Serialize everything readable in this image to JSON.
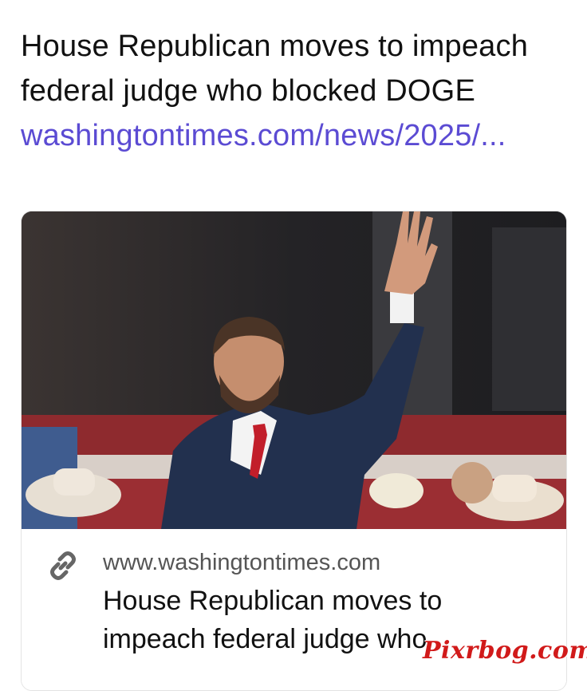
{
  "post": {
    "text": "House Republican moves to impeach federal judge who blocked DOGE",
    "link_text": "washingtontimes.com/news/2025/..."
  },
  "link_card": {
    "domain": "www.washingtontimes.com",
    "title": "House Republican moves to impeach federal judge who",
    "icon": "link-icon"
  },
  "watermark": "Pixrbog.com"
}
